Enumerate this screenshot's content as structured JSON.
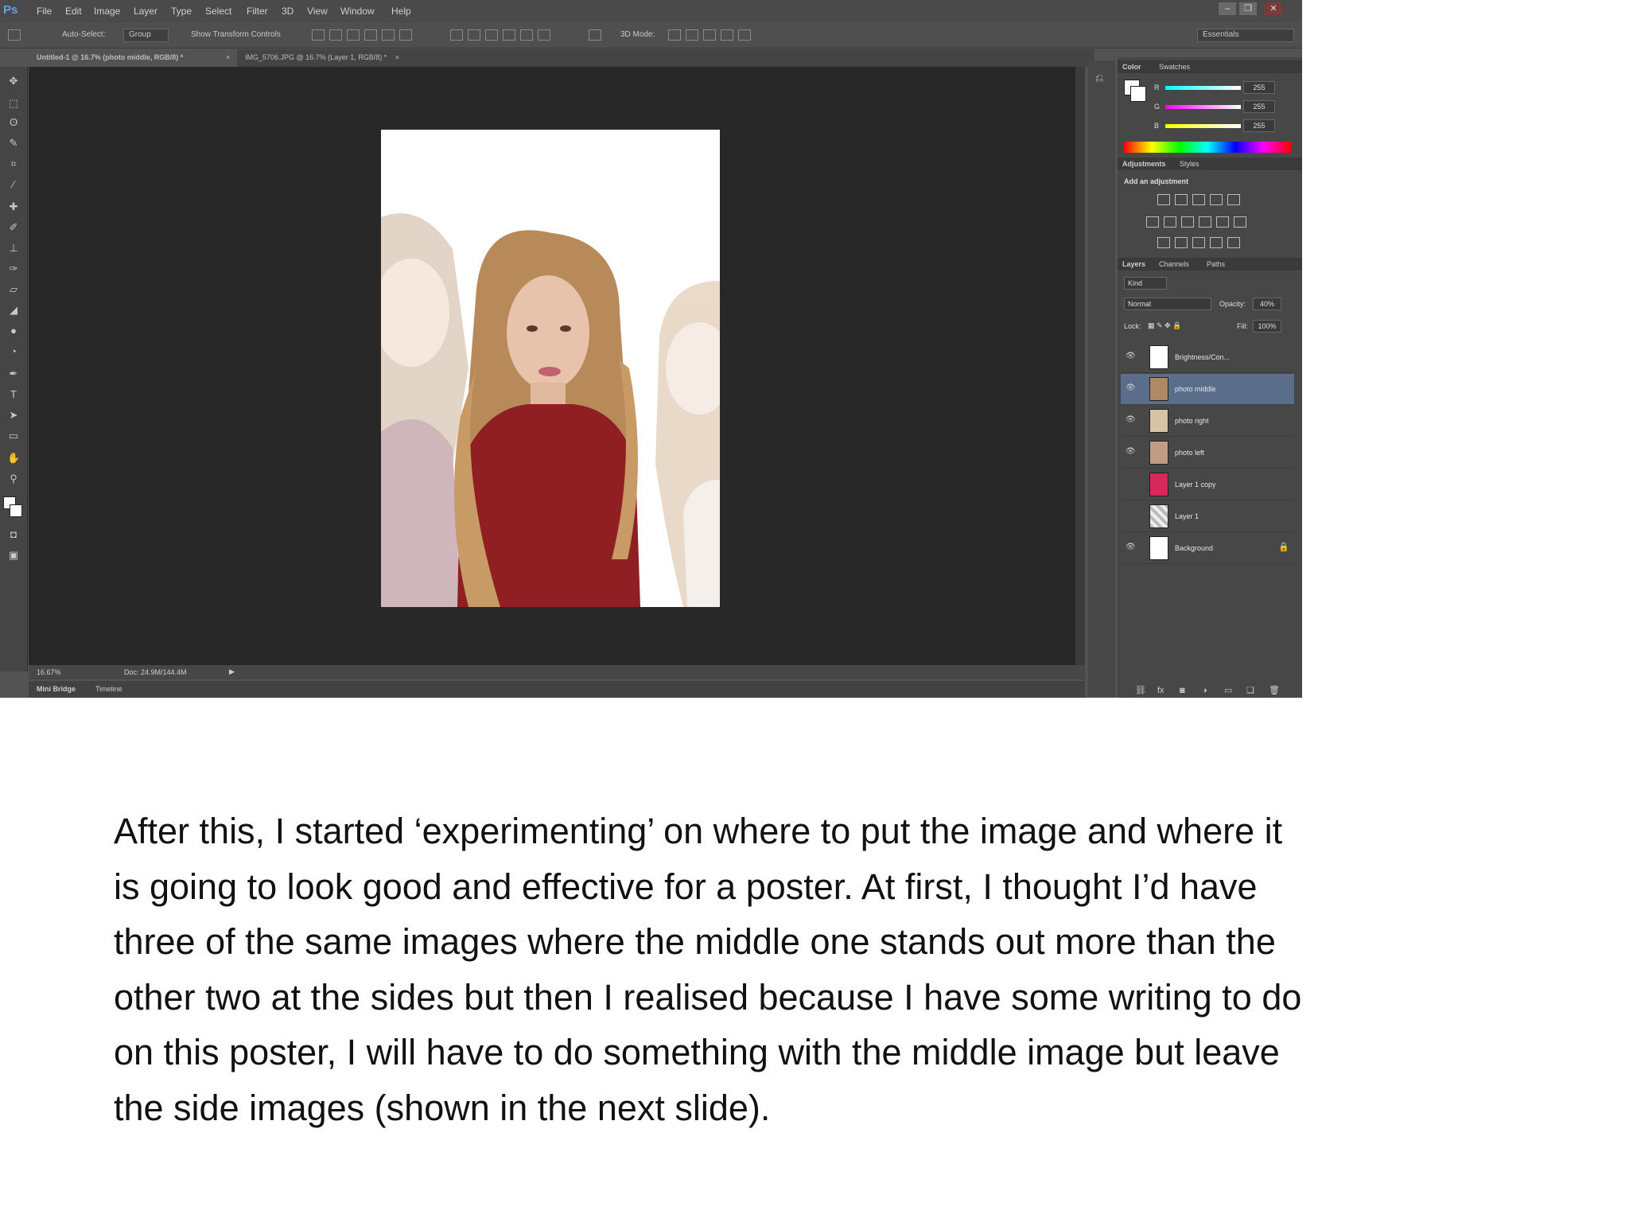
{
  "app": {
    "logo": "Ps"
  },
  "menu": [
    "File",
    "Edit",
    "Image",
    "Layer",
    "Type",
    "Select",
    "Filter",
    "3D",
    "View",
    "Window",
    "Help"
  ],
  "window_controls": {
    "minimize": "–",
    "restore": "❐",
    "close": "✕"
  },
  "options_bar": {
    "auto_select_label": "Auto-Select:",
    "auto_select_value": "Group",
    "show_transform_label": "Show Transform Controls",
    "mode_3d_label": "3D Mode:",
    "workspace": "Essentials"
  },
  "tabs": [
    {
      "label": "Untitled-1 @ 16.7% (photo middle, RGB/8) *",
      "close": "×"
    },
    {
      "label": "IMG_5706.JPG @ 16.7% (Layer 1, RGB/8) *",
      "close": "×"
    }
  ],
  "status": {
    "zoom": "16.67%",
    "doc": "Doc: 24.9M/144.4M"
  },
  "bottom_tabs": [
    "Mini Bridge",
    "Timeline"
  ],
  "color_panel": {
    "tabs": [
      "Color",
      "Swatches"
    ],
    "channels": [
      {
        "label": "R",
        "value": "255",
        "color": "#e03030"
      },
      {
        "label": "G",
        "value": "255",
        "color": "#30c030"
      },
      {
        "label": "B",
        "value": "255",
        "color": "#3050e0"
      }
    ]
  },
  "adjustments_panel": {
    "tabs": [
      "Adjustments",
      "Styles"
    ],
    "heading": "Add an adjustment"
  },
  "layers_panel": {
    "tabs": [
      "Layers",
      "Channels",
      "Paths"
    ],
    "filter_kind": "Kind",
    "blend_mode": "Normal",
    "opacity_label": "Opacity:",
    "opacity_value": "40%",
    "lock_label": "Lock:",
    "fill_label": "Fill:",
    "fill_value": "100%",
    "layers": [
      {
        "name": "Brightness/Con...",
        "thumb": "#ffffff",
        "visible": true,
        "selected": false
      },
      {
        "name": "photo middle",
        "thumb": "#b08866",
        "visible": true,
        "selected": true
      },
      {
        "name": "photo right",
        "thumb": "#d8c2a6",
        "visible": true,
        "selected": false
      },
      {
        "name": "photo left",
        "thumb": "#c29c82",
        "visible": true,
        "selected": false
      },
      {
        "name": "Layer 1 copy",
        "thumb": "#d6285a",
        "visible": false,
        "selected": false
      },
      {
        "name": "Layer 1",
        "thumb": "#9a9a9a",
        "visible": false,
        "selected": false
      },
      {
        "name": "Background",
        "thumb": "#ffffff",
        "visible": true,
        "selected": false,
        "locked": true
      }
    ]
  },
  "caption": {
    "lines": [
      "After this, I started ‘experimenting’ on where to put the image and where it",
      "is going to look good and effective for a poster. At first, I thought I’d have",
      "three of the same images where the middle one stands out more than the",
      "other two at the sides but then I realised because I have some writing to do",
      "on this poster, I will have to do something with the middle image but leave",
      "the side images (shown in the next slide)."
    ]
  }
}
